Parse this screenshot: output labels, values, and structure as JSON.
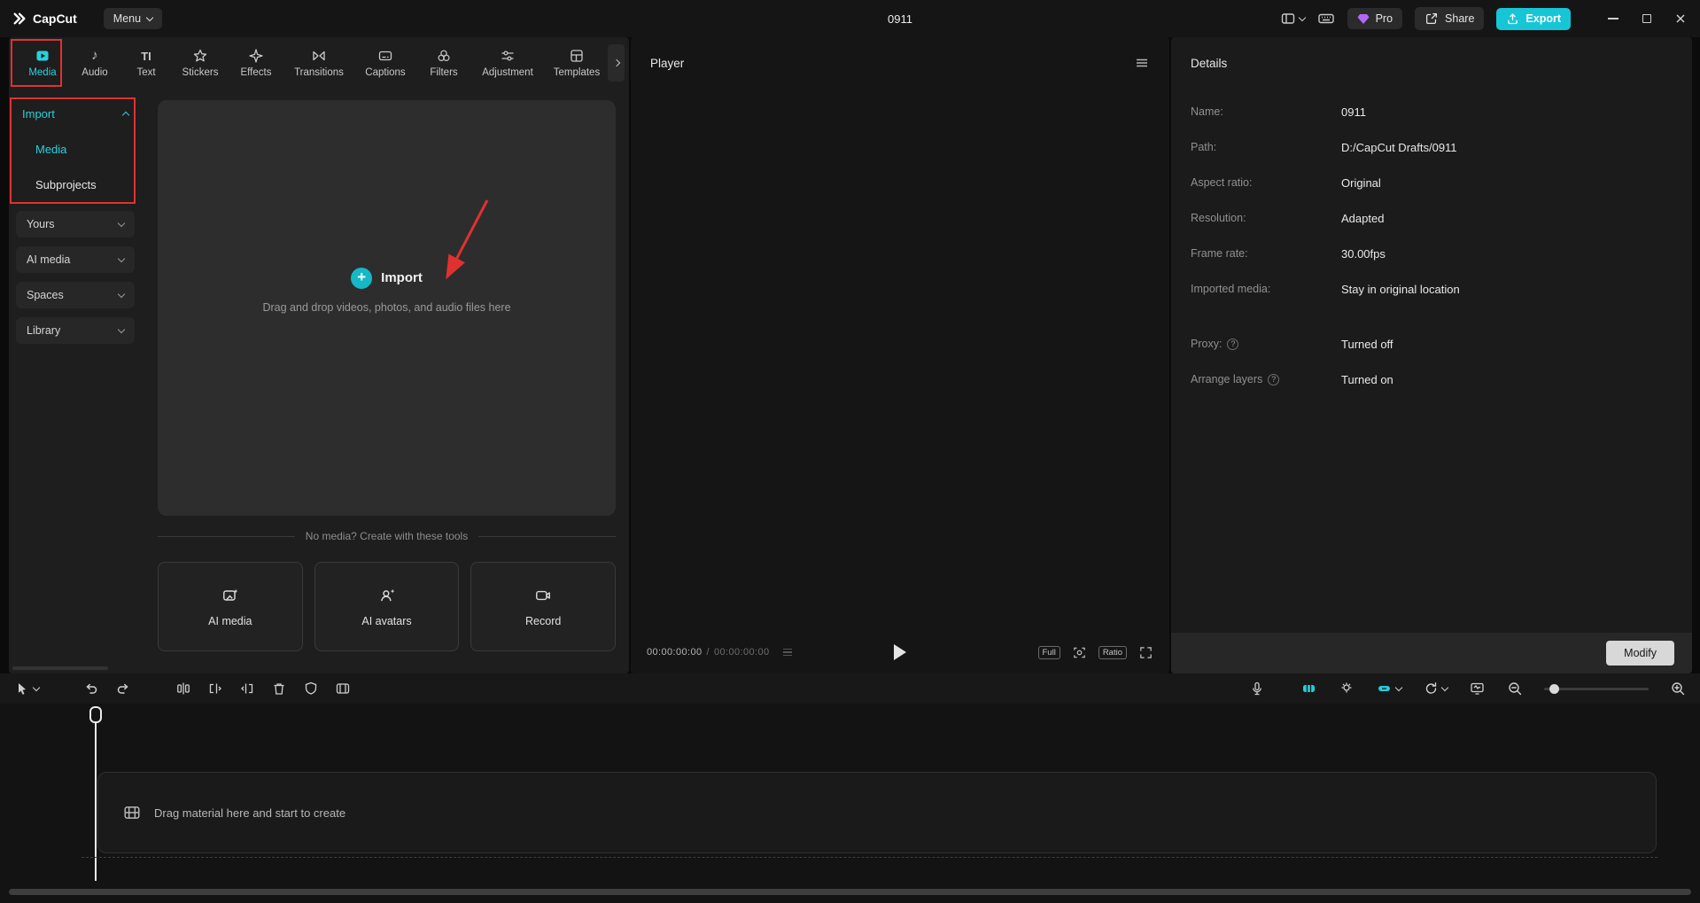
{
  "icons": {
    "plus": "+",
    "music_note": "♪",
    "text_tab": "TI",
    "question": "?"
  },
  "colors": {
    "accent": "#2bd0dc",
    "annotation": "#e03131",
    "export_button": "#16c5d6"
  },
  "titlebar": {
    "app_name": "CapCut",
    "menu": "Menu",
    "project_title": "0911",
    "pro": "Pro",
    "share": "Share",
    "export": "Export"
  },
  "tabs": [
    {
      "label": "Media"
    },
    {
      "label": "Audio"
    },
    {
      "label": "Text"
    },
    {
      "label": "Stickers"
    },
    {
      "label": "Effects"
    },
    {
      "label": "Transitions"
    },
    {
      "label": "Captions"
    },
    {
      "label": "Filters"
    },
    {
      "label": "Adjustment"
    },
    {
      "label": "Templates"
    }
  ],
  "sidebar": {
    "import": "Import",
    "media": "Media",
    "subprojects": "Subprojects",
    "groups": [
      {
        "label": "Yours"
      },
      {
        "label": "AI media"
      },
      {
        "label": "Spaces"
      },
      {
        "label": "Library"
      }
    ]
  },
  "media_panel": {
    "import_button": "Import",
    "drop_hint": "Drag and drop videos, photos, and audio files here",
    "tools_divider": "No media? Create with these tools",
    "tools": [
      {
        "label": "AI media"
      },
      {
        "label": "AI avatars"
      },
      {
        "label": "Record"
      }
    ]
  },
  "player": {
    "title": "Player",
    "time_current": "00:00:00:00",
    "time_separator": "/",
    "time_total": "00:00:00:00",
    "full": "Full",
    "ratio": "Ratio"
  },
  "details": {
    "title": "Details",
    "rows": [
      {
        "label": "Name:",
        "value": "0911"
      },
      {
        "label": "Path:",
        "value": "D:/CapCut Drafts/0911"
      },
      {
        "label": "Aspect ratio:",
        "value": "Original"
      },
      {
        "label": "Resolution:",
        "value": "Adapted"
      },
      {
        "label": "Frame rate:",
        "value": "30.00fps"
      },
      {
        "label": "Imported media:",
        "value": "Stay in original location"
      }
    ],
    "rows2": [
      {
        "label": "Proxy:",
        "value": "Turned off"
      },
      {
        "label": "Arrange layers",
        "value": "Turned on"
      }
    ],
    "modify": "Modify"
  },
  "timeline": {
    "drop_hint": "Drag material here and start to create"
  }
}
